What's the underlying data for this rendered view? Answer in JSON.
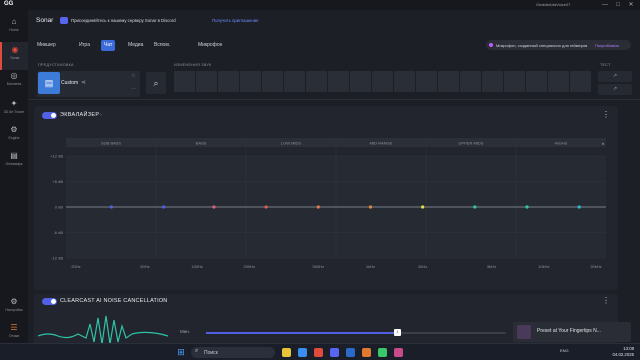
{
  "titlebar": {
    "logo": "GG",
    "user": "GiraldeArtaVoice07",
    "min": "—",
    "max": "□",
    "close": "✕"
  },
  "sidebar": {
    "items": [
      {
        "label": "Home",
        "icon": "home-icon",
        "glyph": "⌂"
      },
      {
        "label": "Sonar",
        "icon": "sonar-icon",
        "glyph": "◉"
      },
      {
        "label": "Moments",
        "icon": "moments-icon",
        "glyph": "◎"
      },
      {
        "label": "3D Art Tracer",
        "icon": "tracer-icon",
        "glyph": "✦"
      },
      {
        "label": "Engine",
        "icon": "engine-icon",
        "glyph": "⚙"
      },
      {
        "label": "Giveaways",
        "icon": "gift-icon",
        "glyph": "▤"
      },
      {
        "label": "Настройки",
        "icon": "settings-icon",
        "glyph": "⚙"
      },
      {
        "label": "Отзыв",
        "icon": "feedback-icon",
        "glyph": "☰"
      }
    ]
  },
  "header": {
    "title": "Sonar",
    "discord_text": "Присоединяйтесь к нашему серверу Sonar в Discord",
    "discord_link": "Получить приглашение"
  },
  "tabs": [
    "Микшер",
    "Игра",
    "Чат",
    "Медиа",
    "Вспом.",
    "Микрофон"
  ],
  "active_tab": "Чат",
  "mic_notice": {
    "text": "Микрофон, созданный специально для геймеров",
    "link": "Попробовать"
  },
  "presets": {
    "header": "ПРЕДУСТАНОВКА",
    "name": "Custom",
    "share": "⟨",
    "star": "☆",
    "more": "…"
  },
  "changes": {
    "header": "ИЗМЕНЕНИЯ ЗВУК"
  },
  "test": {
    "header": "ТЕСТ",
    "btn1": "↗",
    "btn2": "↗"
  },
  "equalizer": {
    "title": "ЭКВАЛАЙЗЕР",
    "info": "›",
    "menu": "⋮",
    "accent": "#5260e3"
  },
  "chart_data": {
    "type": "line",
    "bands": [
      "SUB BASS",
      "BASS",
      "LOW MIDS",
      "MID RANGE",
      "UPPER MIDS",
      "HIGHS"
    ],
    "x": [
      "20Hz",
      "50Hz",
      "100Hz",
      "200Hz",
      "500Hz",
      "1kHz",
      "2kHz",
      "5kHz",
      "10kHz",
      "20kHz"
    ],
    "y_ticks": [
      "+12 dB",
      "+6 dB",
      "0 dB",
      "-6 dB",
      "-12 dB"
    ],
    "ylim": [
      -12,
      12
    ],
    "points": [
      {
        "x": 32,
        "y": 0,
        "color": "#5260e3"
      },
      {
        "x": 64,
        "y": 0,
        "color": "#5260e3"
      },
      {
        "x": 125,
        "y": 0,
        "color": "#e0607a"
      },
      {
        "x": 250,
        "y": 0,
        "color": "#e05a5a"
      },
      {
        "x": 500,
        "y": 0,
        "color": "#e07a50"
      },
      {
        "x": 1000,
        "y": 0,
        "color": "#e08a40"
      },
      {
        "x": 2000,
        "y": 0,
        "color": "#e8e040"
      },
      {
        "x": 4000,
        "y": 0,
        "color": "#30c8a8"
      },
      {
        "x": 8000,
        "y": 0,
        "color": "#30c8a8"
      },
      {
        "x": 16000,
        "y": 0,
        "color": "#30b8d8"
      }
    ]
  },
  "clearcast": {
    "title": "CLEARCAST AI NOISE CANCELLATION",
    "info": "›",
    "menu": "⋮",
    "label": "Мин.",
    "level": 0.64,
    "thumb": "1"
  },
  "toast": {
    "text": "Preset at Your Fingertips N..."
  },
  "taskbar": {
    "search": "Поиск",
    "lang": "ENG",
    "time": "13:08",
    "date": "04.02.2025"
  }
}
